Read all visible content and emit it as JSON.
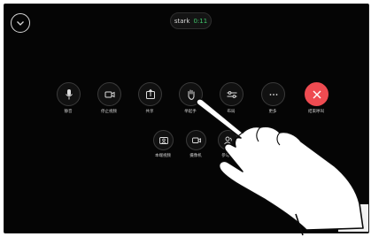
{
  "call": {
    "name": "stark",
    "timer": "0:11"
  },
  "controls": [
    {
      "id": "mute",
      "label": "静音",
      "icon": "microphone-icon"
    },
    {
      "id": "stop-video",
      "label": "停止视频",
      "icon": "camera-icon"
    },
    {
      "id": "share",
      "label": "共享",
      "icon": "share-icon"
    },
    {
      "id": "raise-hand",
      "label": "举起手",
      "icon": "hand-icon"
    },
    {
      "id": "layout",
      "label": "布局",
      "icon": "sliders-icon"
    },
    {
      "id": "more",
      "label": "更多",
      "icon": "more-icon"
    },
    {
      "id": "end-call",
      "label": "结束呼叫",
      "icon": "close-icon"
    }
  ],
  "secondary": [
    {
      "id": "self-view",
      "label": "本端视频",
      "icon": "self-view-icon"
    },
    {
      "id": "camera",
      "label": "摄像机",
      "icon": "camera-control-icon"
    },
    {
      "id": "participants",
      "label": "参与者",
      "icon": "participants-icon"
    }
  ],
  "colors": {
    "background": "#050505",
    "end_call": "#ee4b51",
    "timer": "#3fc56a"
  }
}
